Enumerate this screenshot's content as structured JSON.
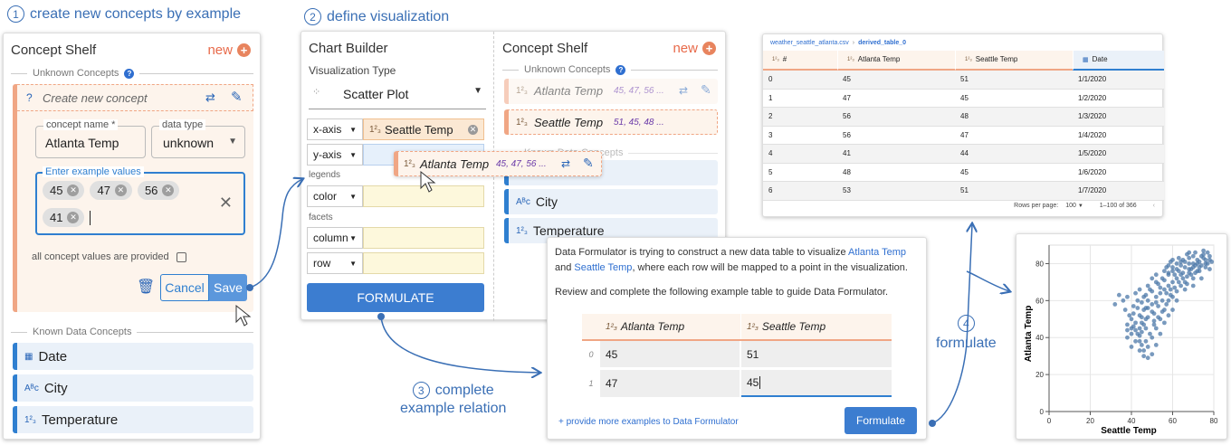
{
  "steps": {
    "s1": {
      "num": "1",
      "label": "create new concepts by example"
    },
    "s2": {
      "num": "2",
      "label": "define visualization"
    },
    "s3": {
      "num": "3",
      "line1": "complete",
      "line2": "example relation"
    },
    "s4": {
      "num": "4",
      "label": "formulate"
    }
  },
  "shelf1": {
    "title": "Concept Shelf",
    "new_label": "new",
    "unknown_label": "Unknown Concepts",
    "create_placeholder": "Create new concept",
    "concept_name_label": "concept name *",
    "concept_name_value": "Atlanta Temp",
    "data_type_label": "data type",
    "data_type_value": "unknown",
    "examples_label": "Enter example values",
    "chips": [
      "45",
      "47",
      "56",
      "41"
    ],
    "all_provided_label": "all concept values are provided",
    "cancel": "Cancel",
    "save": "Save",
    "known_label": "Known Data Concepts",
    "known": [
      {
        "icon": "calendar-icon",
        "glyph": "▦",
        "label": "Date"
      },
      {
        "icon": "string-type-icon",
        "glyph": "Aᴮᶜ",
        "label": "City"
      },
      {
        "icon": "numeric-type-icon",
        "glyph": "1²₃",
        "label": "Temperature"
      }
    ]
  },
  "builder": {
    "title": "Chart Builder",
    "vis_type_label": "Visualization Type",
    "vis_type": "Scatter Plot",
    "xaxis": "x-axis",
    "x_field": "Seattle Temp",
    "yaxis": "y-axis",
    "legends": "legends",
    "color": "color",
    "facets": "facets",
    "column": "column",
    "row": "row",
    "formulate": "FORMULATE",
    "drag_label": "Atlanta Temp",
    "drag_values": "45, 47, 56 ..."
  },
  "shelf2": {
    "title": "Concept Shelf",
    "new_label": "new",
    "unknown_label": "Unknown Concepts",
    "c1_name": "Atlanta Temp",
    "c1_values": "45, 47, 56 ...",
    "c2_name": "Seattle Temp",
    "c2_values": "51, 45, 48 ...",
    "known_label": "Known Data Concepts",
    "known": [
      {
        "icon": "string-type-icon",
        "label": "City"
      },
      {
        "icon": "numeric-type-icon",
        "label": "Temperature"
      }
    ]
  },
  "dialog": {
    "p1a": "Data Formulator is trying to construct a new data table to visualize ",
    "p1_link1": "Atlanta Temp",
    "p1b": " and ",
    "p1_link2": "Seattle Temp",
    "p1c": ", where each row will be mapped to a point in the visualization.",
    "p2": "Review and complete the following example table to guide Data Formulator.",
    "col1": "Atlanta Temp",
    "col2": "Seattle Temp",
    "rows": [
      {
        "idx": "0",
        "a": "45",
        "s": "51"
      },
      {
        "idx": "1",
        "a": "47",
        "s": "45"
      }
    ],
    "more_link": "+ provide more examples to Data Formulator",
    "formulate": "Formulate"
  },
  "table": {
    "breadcrumb_file": "weather_seattle_atlanta.csv",
    "breadcrumb_sep": "›",
    "breadcrumb_table": "derived_table_0",
    "headers": [
      "#",
      "Atlanta Temp",
      "Seattle Temp",
      "Date"
    ],
    "rows": [
      [
        "0",
        "45",
        "51",
        "1/1/2020"
      ],
      [
        "1",
        "47",
        "45",
        "1/2/2020"
      ],
      [
        "2",
        "56",
        "48",
        "1/3/2020"
      ],
      [
        "3",
        "56",
        "47",
        "1/4/2020"
      ],
      [
        "4",
        "41",
        "44",
        "1/5/2020"
      ],
      [
        "5",
        "48",
        "45",
        "1/6/2020"
      ],
      [
        "6",
        "53",
        "51",
        "1/7/2020"
      ]
    ],
    "rows_per_page_label": "Rows per page:",
    "rows_per_page": "100",
    "range": "1–100 of 366"
  },
  "chart_data": {
    "type": "scatter",
    "xlabel": "Seattle Temp",
    "ylabel": "Atlanta Temp",
    "xlim": [
      0,
      80
    ],
    "ylim": [
      0,
      90
    ],
    "xticks": [
      "0",
      "20",
      "40",
      "60",
      "80"
    ],
    "yticks": [
      "0",
      "20",
      "40",
      "60",
      "80"
    ],
    "grid": true,
    "points": [
      [
        45,
        51
      ],
      [
        47,
        45
      ],
      [
        48,
        56
      ],
      [
        47,
        56
      ],
      [
        44,
        41
      ],
      [
        45,
        48
      ],
      [
        51,
        53
      ],
      [
        38,
        47
      ],
      [
        40,
        50
      ],
      [
        42,
        44
      ],
      [
        43,
        60
      ],
      [
        46,
        62
      ],
      [
        50,
        65
      ],
      [
        52,
        70
      ],
      [
        55,
        72
      ],
      [
        58,
        75
      ],
      [
        60,
        78
      ],
      [
        62,
        80
      ],
      [
        65,
        82
      ],
      [
        68,
        83
      ],
      [
        70,
        84
      ],
      [
        72,
        80
      ],
      [
        75,
        85
      ],
      [
        78,
        82
      ],
      [
        76,
        78
      ],
      [
        73,
        76
      ],
      [
        70,
        72
      ],
      [
        68,
        75
      ],
      [
        66,
        70
      ],
      [
        64,
        68
      ],
      [
        62,
        72
      ],
      [
        60,
        70
      ],
      [
        58,
        68
      ],
      [
        56,
        66
      ],
      [
        54,
        64
      ],
      [
        52,
        62
      ],
      [
        50,
        58
      ],
      [
        48,
        60
      ],
      [
        46,
        55
      ],
      [
        44,
        52
      ],
      [
        42,
        48
      ],
      [
        40,
        45
      ],
      [
        38,
        40
      ],
      [
        40,
        35
      ],
      [
        42,
        38
      ],
      [
        44,
        33
      ],
      [
        46,
        30
      ],
      [
        48,
        35
      ],
      [
        50,
        40
      ],
      [
        52,
        45
      ],
      [
        54,
        50
      ],
      [
        56,
        55
      ],
      [
        58,
        60
      ],
      [
        60,
        62
      ],
      [
        62,
        65
      ],
      [
        64,
        74
      ],
      [
        66,
        78
      ],
      [
        68,
        80
      ],
      [
        70,
        78
      ],
      [
        72,
        82
      ],
      [
        74,
        84
      ],
      [
        76,
        80
      ],
      [
        78,
        77
      ],
      [
        55,
        60
      ],
      [
        57,
        64
      ],
      [
        59,
        66
      ],
      [
        61,
        74
      ],
      [
        63,
        76
      ],
      [
        65,
        75
      ],
      [
        67,
        73
      ],
      [
        69,
        77
      ],
      [
        71,
        79
      ],
      [
        73,
        81
      ],
      [
        75,
        83
      ],
      [
        77,
        86
      ],
      [
        53,
        57
      ],
      [
        51,
        49
      ],
      [
        49,
        42
      ],
      [
        47,
        38
      ],
      [
        45,
        36
      ],
      [
        43,
        42
      ],
      [
        41,
        46
      ],
      [
        39,
        52
      ],
      [
        37,
        55
      ],
      [
        36,
        60
      ],
      [
        38,
        62
      ],
      [
        41,
        57
      ],
      [
        44,
        45
      ],
      [
        46,
        47
      ],
      [
        48,
        51
      ],
      [
        50,
        54
      ],
      [
        52,
        59
      ],
      [
        54,
        67
      ],
      [
        56,
        71
      ],
      [
        58,
        74
      ],
      [
        60,
        76
      ],
      [
        62,
        77
      ],
      [
        64,
        79
      ],
      [
        66,
        81
      ],
      [
        68,
        77
      ],
      [
        70,
        80
      ],
      [
        72,
        76
      ],
      [
        74,
        79
      ],
      [
        76,
        82
      ],
      [
        78,
        84
      ],
      [
        62,
        60
      ],
      [
        66,
        66
      ],
      [
        70,
        68
      ],
      [
        74,
        72
      ],
      [
        56,
        48
      ],
      [
        58,
        52
      ],
      [
        60,
        55
      ],
      [
        34,
        63
      ],
      [
        32,
        58
      ],
      [
        47,
        63
      ],
      [
        49,
        66
      ],
      [
        53,
        69
      ],
      [
        57,
        78
      ],
      [
        59,
        81
      ],
      [
        63,
        83
      ],
      [
        67,
        85
      ],
      [
        71,
        86
      ],
      [
        75,
        87
      ],
      [
        79,
        81
      ],
      [
        45,
        43
      ],
      [
        43,
        56
      ],
      [
        41,
        53
      ],
      [
        45,
        59
      ],
      [
        47,
        50
      ],
      [
        51,
        47
      ],
      [
        53,
        51
      ],
      [
        55,
        54
      ],
      [
        57,
        58
      ],
      [
        59,
        63
      ],
      [
        61,
        67
      ],
      [
        63,
        70
      ],
      [
        65,
        72
      ],
      [
        67,
        69
      ],
      [
        69,
        74
      ],
      [
        71,
        75
      ],
      [
        73,
        78
      ],
      [
        77,
        80
      ],
      [
        46,
        33
      ],
      [
        50,
        31
      ],
      [
        44,
        38
      ],
      [
        40,
        42
      ],
      [
        38,
        44
      ],
      [
        48,
        29
      ],
      [
        52,
        36
      ],
      [
        54,
        42
      ],
      [
        42,
        64
      ],
      [
        44,
        66
      ],
      [
        48,
        68
      ],
      [
        50,
        72
      ],
      [
        52,
        74
      ],
      [
        56,
        76
      ],
      [
        58,
        79
      ],
      [
        60,
        82
      ],
      [
        64,
        81
      ],
      [
        68,
        86
      ]
    ]
  }
}
